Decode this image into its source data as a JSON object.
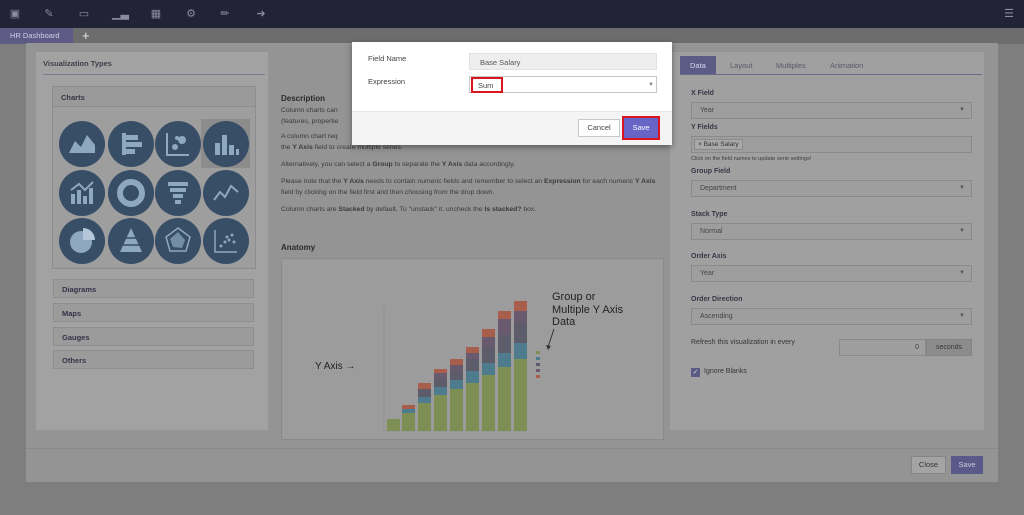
{
  "toolbar": {
    "icons": [
      "save-icon",
      "edit-icon",
      "trash-icon",
      "bar-chart-icon",
      "grid-icon",
      "gear-icon",
      "brush-icon",
      "signout-icon",
      "menu-icon"
    ]
  },
  "tabs": {
    "active_tab": "HR Dashboard",
    "add_label": "+"
  },
  "viz_panel": {
    "title": "Visualization Types",
    "charts_heading": "Charts",
    "categories": [
      "Diagrams",
      "Maps",
      "Gauges",
      "Others"
    ]
  },
  "description": {
    "heading": "Description",
    "line1": "Column charts can",
    "line2": "(features, propertie",
    "p2a": "A column chart req",
    "p2b_bold": "Y Axis",
    "p2b": " field to create multiple series.",
    "p3a": "Alternatively, you can select a ",
    "p3_group": "Group",
    "p3b": " to separate the ",
    "p3_yaxis": "Y Axis",
    "p3c": " data accordingly.",
    "p4a": "Please note that the ",
    "p4_yaxis": "Y Axis",
    "p4b": " needs to contain numeric fields and remember to select an ",
    "p4_expr": "Expression",
    "p4c": " for each numeric ",
    "p4_yaxis2": "Y Axis",
    "p4d": " field by clicking on the field first and then choosing from the drop down.",
    "p5a": "Column charts are ",
    "p5_stacked": "Stacked",
    "p5b": " by default. To \"unstack\" it, uncheck the ",
    "p5_is": "Is stacked?",
    "p5c": " box.",
    "anatomy_heading": "Anatomy",
    "anatomy_y_axis": "Y Axis →",
    "anatomy_group_1": "Group or",
    "anatomy_group_2": "Multiple Y Axis",
    "anatomy_group_3": "Data"
  },
  "data_panel": {
    "tabs": [
      "Data",
      "Layout",
      "Multiples",
      "Animation"
    ],
    "x_field_label": "X Field",
    "x_field_value": "Year",
    "y_fields_label": "Y Fields",
    "y_field_chip": "× Base Salary",
    "y_fields_hint": "Click on the field names to update serie settings!",
    "group_field_label": "Group Field",
    "group_field_value": "Department",
    "stack_type_label": "Stack Type",
    "stack_type_value": "Normal",
    "order_axis_label": "Order Axis",
    "order_axis_value": "Year",
    "order_direction_label": "Order Direction",
    "order_direction_value": "Ascending",
    "refresh_label": "Refresh this visualization in every",
    "refresh_value": "0",
    "refresh_unit": "seconds",
    "ignore_blanks_label": "Ignore Blanks",
    "ignore_blanks_checked": true
  },
  "footer": {
    "close_label": "Close",
    "save_label": "Save"
  },
  "dialog": {
    "field_name_label": "Field Name",
    "field_name_value": "Base Salary",
    "expression_label": "Expression",
    "expression_value": "Sum",
    "cancel_label": "Cancel",
    "save_label": "Save",
    "highlight_color": "#d9151e",
    "save_color": "#6766c6"
  }
}
